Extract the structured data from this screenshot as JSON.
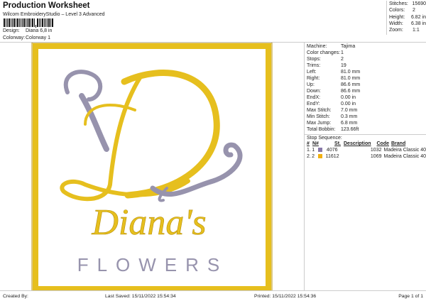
{
  "header": {
    "title": "Production Worksheet",
    "subtitle": "Wilcom EmbroideryStudio – Level 3 Advanced",
    "design_label": "Design:",
    "design_value": "Diana 6,8 in",
    "colorway_label": "Colorway:",
    "colorway_value": "Colorway 1"
  },
  "top_stats": [
    {
      "k": "Stitches:",
      "v": "15690"
    },
    {
      "k": "Colors:",
      "v": "2"
    },
    {
      "k": "Height:",
      "v": "6.82 in"
    },
    {
      "k": "Width:",
      "v": "6.38 in"
    },
    {
      "k": "Zoom:",
      "v": "1:1"
    }
  ],
  "details": [
    {
      "k": "Machine:",
      "v": "Tajima"
    },
    {
      "k": "Color changes:",
      "v": "1"
    },
    {
      "k": "Stops:",
      "v": "2"
    },
    {
      "k": "Trims:",
      "v": "19"
    },
    {
      "k": "Left:",
      "v": "81.0 mm"
    },
    {
      "k": "Right:",
      "v": "81.0 mm"
    },
    {
      "k": "Up:",
      "v": "86.6 mm"
    },
    {
      "k": "Down:",
      "v": "86.6 mm"
    },
    {
      "k": "EndX:",
      "v": "0.00 in"
    },
    {
      "k": "EndY:",
      "v": "0.00 in"
    },
    {
      "k": "Max Stitch:",
      "v": "7.0 mm"
    },
    {
      "k": "Min Stitch:",
      "v": "0.3 mm"
    },
    {
      "k": "Max Jump:",
      "v": "6.8 mm"
    },
    {
      "k": "Total Bobbin:",
      "v": "123.66ft"
    }
  ],
  "stop_sequence": {
    "title": "Stop Sequence:",
    "headers": [
      "#",
      "N#",
      "",
      "St.",
      "Description",
      "Code",
      "Brand"
    ],
    "rows": [
      {
        "n": "1.",
        "nn": "1",
        "color": "#8878a8",
        "st": "4076",
        "desc": "",
        "code": "1032",
        "brand": "Madeira Classic 40"
      },
      {
        "n": "2.",
        "nn": "2",
        "color": "#f2b010",
        "st": "11612",
        "desc": "",
        "code": "1069",
        "brand": "Madeira Classic 40"
      }
    ]
  },
  "logo": {
    "text1": "Diana's",
    "text2": "FLOWERS",
    "gold": "#e6bf1e",
    "lavender": "#9793ad"
  },
  "footer": {
    "created": "Created By:",
    "saved": "Last Saved: 15/11/2022 15:54:34",
    "printed": "Printed: 15/11/2022 15:54:36",
    "page": "Page 1 of 1"
  }
}
